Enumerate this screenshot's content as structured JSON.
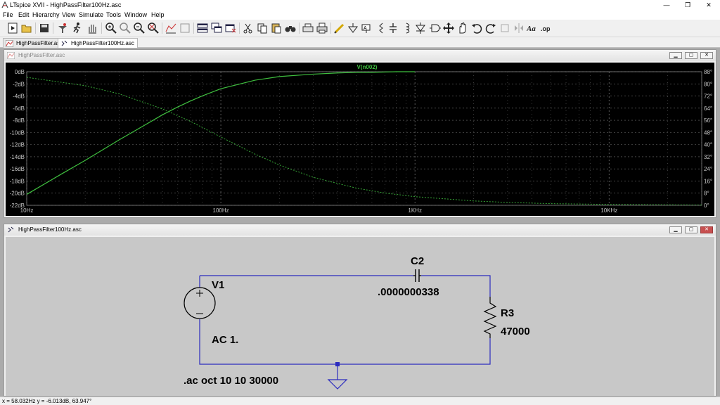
{
  "window": {
    "title": "LTspice XVII - HighPassFilter100Hz.asc",
    "minimize": "—",
    "maximize": "❐",
    "close": "✕"
  },
  "menu": [
    "File",
    "Edit",
    "Hierarchy",
    "View",
    "Simulate",
    "Tools",
    "Window",
    "Help"
  ],
  "tabs": [
    {
      "label": "HighPassFilter.asc",
      "active": false
    },
    {
      "label": "HighPassFilter100Hz.asc",
      "active": true
    }
  ],
  "plot_window": {
    "title": "HighPassFilter.asc",
    "trace_label": "V(n002)"
  },
  "schematic_window": {
    "title": "HighPassFilter100Hz.asc",
    "components": {
      "source_name": "V1",
      "source_value": "AC 1.",
      "cap_name": "C2",
      "cap_value": ".0000000338",
      "res_name": "R3",
      "res_value": "47000",
      "directive": ".ac oct 10 10 30000"
    }
  },
  "status": {
    "cursor_readout": "x = 58.032Hz    y = -6.013dB, 63.947°"
  },
  "colors": {
    "plot_bg": "#000000",
    "trace": "#3fbf3f",
    "grid": "#707070",
    "schematic_bg": "#c8c8c8",
    "wire": "#2b2bbf"
  },
  "chart_data": {
    "type": "line",
    "title": "V(n002)",
    "xscale": "log",
    "xlim": [
      10,
      30000
    ],
    "x_tick_labels": [
      "10Hz",
      "100Hz",
      "1KHz",
      "10KHz"
    ],
    "ylim": [
      -22,
      0
    ],
    "y_tick_labels": [
      "0dB",
      "-2dB",
      "-4dB",
      "-6dB",
      "-8dB",
      "-10dB",
      "-12dB",
      "-14dB",
      "-16dB",
      "-18dB",
      "-20dB",
      "-22dB"
    ],
    "y2lim": [
      0,
      88
    ],
    "y2_tick_labels": [
      "88°",
      "80°",
      "72°",
      "64°",
      "56°",
      "48°",
      "40°",
      "32°",
      "24°",
      "16°",
      "8°",
      "0°"
    ],
    "grid": true,
    "series": [
      {
        "name": "V(n002)",
        "x": [
          10,
          15,
          20,
          30,
          40,
          50,
          60,
          70,
          80,
          100,
          150,
          200,
          300,
          400,
          500,
          600,
          800,
          1000
        ],
        "values": [
          -20.2,
          -16.9,
          -14.6,
          -11.2,
          -8.9,
          -7.1,
          -5.8,
          -4.8,
          -4.0,
          -2.8,
          -1.4,
          -0.8,
          -0.4,
          -0.2,
          -0.1,
          -0.1,
          0,
          0
        ]
      },
      {
        "name": "phase",
        "axis": "right",
        "x": [
          10,
          20,
          30,
          50,
          70,
          100,
          150,
          200,
          300,
          500,
          700,
          1000,
          2000,
          3000,
          5000,
          10000,
          30000
        ],
        "values": [
          84.3,
          78.8,
          73.4,
          63.5,
          55.2,
          45.0,
          33.7,
          26.6,
          18.4,
          11.3,
          8.1,
          5.7,
          2.9,
          1.9,
          1.1,
          0.6,
          0.2
        ]
      }
    ]
  }
}
